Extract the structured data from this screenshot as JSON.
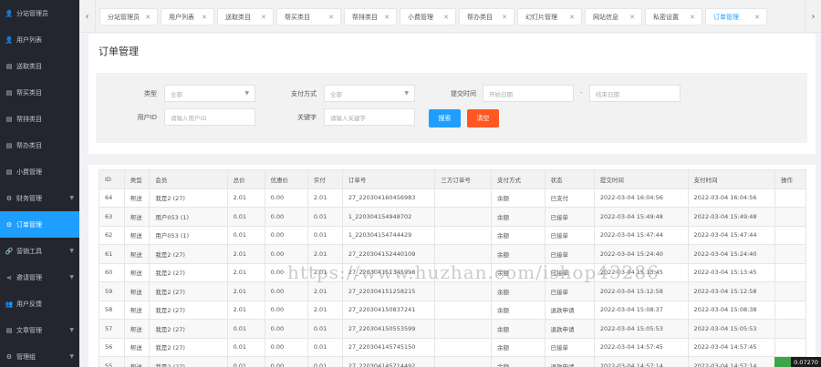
{
  "sidebar": {
    "items": [
      {
        "label": "分站管理员",
        "icon": "user-icon",
        "glyph": "👤",
        "arrow": false,
        "active": false
      },
      {
        "label": "用户列表",
        "icon": "user-icon",
        "glyph": "👤",
        "arrow": false,
        "active": false
      },
      {
        "label": "送取类目",
        "icon": "document-icon",
        "glyph": "▤",
        "arrow": false,
        "active": false
      },
      {
        "label": "帮买类目",
        "icon": "document-icon",
        "glyph": "▤",
        "arrow": false,
        "active": false
      },
      {
        "label": "帮排类目",
        "icon": "document-icon",
        "glyph": "▤",
        "arrow": false,
        "active": false
      },
      {
        "label": "帮办类目",
        "icon": "document-icon",
        "glyph": "▤",
        "arrow": false,
        "active": false
      },
      {
        "label": "小费管理",
        "icon": "document-icon",
        "glyph": "▤",
        "arrow": false,
        "active": false
      },
      {
        "label": "财务管理",
        "icon": "gear-icon",
        "glyph": "⚙",
        "arrow": true,
        "active": false
      },
      {
        "label": "订单管理",
        "icon": "gear-icon",
        "glyph": "⚙",
        "arrow": false,
        "active": true
      },
      {
        "label": "营销工具",
        "icon": "link-icon",
        "glyph": "🔗",
        "arrow": true,
        "active": false
      },
      {
        "label": "邀请管理",
        "icon": "share-icon",
        "glyph": "⋖",
        "arrow": true,
        "active": false
      },
      {
        "label": "用户反馈",
        "icon": "users-icon",
        "glyph": "👥",
        "arrow": false,
        "active": false
      },
      {
        "label": "文章管理",
        "icon": "document-icon",
        "glyph": "▤",
        "arrow": true,
        "active": false
      },
      {
        "label": "管理组",
        "icon": "gear-icon",
        "glyph": "⚙",
        "arrow": true,
        "active": false
      }
    ]
  },
  "tabs": [
    {
      "label": "分站管理员",
      "active": false
    },
    {
      "label": "用户列表",
      "active": false
    },
    {
      "label": "送取类目",
      "active": false
    },
    {
      "label": "帮买类目",
      "active": false
    },
    {
      "label": "帮排类目",
      "active": false
    },
    {
      "label": "小费管理",
      "active": false
    },
    {
      "label": "帮办类目",
      "active": false
    },
    {
      "label": "幻灯片管理",
      "active": false
    },
    {
      "label": "网站信息",
      "active": false
    },
    {
      "label": "私密设置",
      "active": false
    },
    {
      "label": "订单管理",
      "active": true
    }
  ],
  "tab_close": "✕",
  "tab_prev": "‹",
  "tab_next": "›",
  "page_title": "订单管理",
  "filters": {
    "type_label": "类型",
    "type_value": "全部",
    "pay_label": "支付方式",
    "pay_value": "全部",
    "time_label": "提交时间",
    "start_placeholder": "开始日期",
    "date_dash": "-",
    "end_placeholder": "结束日期",
    "uid_label": "用户ID",
    "uid_placeholder": "请输入用户ID",
    "keyword_label": "关键字",
    "keyword_placeholder": "请输入关键字",
    "search_btn": "搜索",
    "clear_btn": "清空"
  },
  "table": {
    "headers": [
      "ID",
      "类型",
      "会员",
      "总价",
      "优惠价",
      "实付",
      "订单号",
      "三方订单号",
      "支付方式",
      "状态",
      "提交时间",
      "支付时间",
      "操作"
    ],
    "rows": [
      [
        "64",
        "帮送",
        "我是2 (27)",
        "2.01",
        "0.00",
        "2.01",
        "27_220304160456983",
        "",
        "余额",
        "已支付",
        "2022-03-04 16:04:56",
        "2022-03-04 16:04:56",
        ""
      ],
      [
        "63",
        "帮送",
        "用户053 (1)",
        "0.01",
        "0.00",
        "0.01",
        "1_220304154948702",
        "",
        "余额",
        "已接单",
        "2022-03-04 15:49:48",
        "2022-03-04 15:49:48",
        ""
      ],
      [
        "62",
        "帮送",
        "用户053 (1)",
        "0.01",
        "0.00",
        "0.01",
        "1_220304154744429",
        "",
        "余额",
        "已接单",
        "2022-03-04 15:47:44",
        "2022-03-04 15:47:44",
        ""
      ],
      [
        "61",
        "帮送",
        "我是2 (27)",
        "2.01",
        "0.00",
        "2.01",
        "27_220304152440109",
        "",
        "余额",
        "已接单",
        "2022-03-04 15:24:40",
        "2022-03-04 15:24:40",
        ""
      ],
      [
        "60",
        "帮送",
        "我是2 (27)",
        "2.01",
        "0.00",
        "2.01",
        "27_220304151345998",
        "",
        "余额",
        "已接单",
        "2022-03-04 15:13:45",
        "2022-03-04 15:13:45",
        ""
      ],
      [
        "59",
        "帮送",
        "我是2 (27)",
        "2.01",
        "0.00",
        "2.01",
        "27_220304151258215",
        "",
        "余额",
        "已接单",
        "2022-03-04 15:12:58",
        "2022-03-04 15:12:58",
        ""
      ],
      [
        "58",
        "帮送",
        "我是2 (27)",
        "2.01",
        "0.00",
        "2.01",
        "27_220304150837241",
        "",
        "余额",
        "退款申请",
        "2022-03-04 15:08:37",
        "2022-03-04 15:08:38",
        ""
      ],
      [
        "57",
        "帮送",
        "我是2 (27)",
        "0.01",
        "0.00",
        "0.01",
        "27_220304150553599",
        "",
        "余额",
        "退款申请",
        "2022-03-04 15:05:53",
        "2022-03-04 15:05:53",
        ""
      ],
      [
        "56",
        "帮送",
        "我是2 (27)",
        "0.01",
        "0.00",
        "0.01",
        "27_220304145745150",
        "",
        "余额",
        "已接单",
        "2022-03-04 14:57:45",
        "2022-03-04 14:57:45",
        ""
      ],
      [
        "55",
        "帮送",
        "我是2 (27)",
        "0.01",
        "0.00",
        "0.01",
        "27_220304145714492",
        "",
        "余额",
        "退款申请",
        "2022-03-04 14:57:14",
        "2022-03-04 14:57:14",
        ""
      ]
    ]
  },
  "watermark": "https://www.huzhan.com/ishop43286",
  "corner_value": "0.07270",
  "colors": {
    "accent": "#1e9fff",
    "danger": "#ff5722",
    "sidebar": "#23262e"
  }
}
